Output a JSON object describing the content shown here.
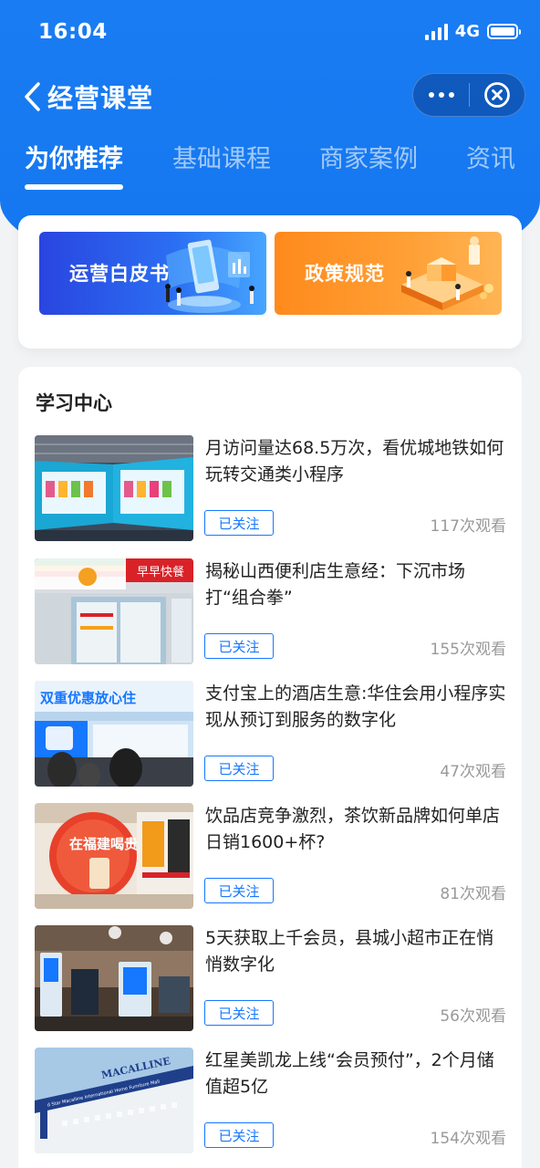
{
  "status_bar": {
    "time": "16:04",
    "network": "4G"
  },
  "nav": {
    "title": "经营课堂"
  },
  "tabs": [
    {
      "label": "为你推荐",
      "active": true
    },
    {
      "label": "基础课程",
      "active": false
    },
    {
      "label": "商家案例",
      "active": false
    },
    {
      "label": "资讯",
      "active": false
    }
  ],
  "banners": [
    {
      "label": "运营白皮书",
      "color": "#2b5ff0"
    },
    {
      "label": "政策规范",
      "color": "#ff9a2e"
    }
  ],
  "learning": {
    "title": "学习中心",
    "items": [
      {
        "title": "月访问量达68.5万次，看优城地铁如何玩转交通类小程序",
        "follow": "已关注",
        "views": "117次观看"
      },
      {
        "title": "揭秘山西便利店生意经：下沉市场打“组合拳”",
        "follow": "已关注",
        "views": "155次观看"
      },
      {
        "title": "支付宝上的酒店生意:华住会用小程序实现从预订到服务的数字化",
        "follow": "已关注",
        "views": "47次观看"
      },
      {
        "title": "饮品店竞争激烈，茶饮新品牌如何单店日销1600+杯?",
        "follow": "已关注",
        "views": "81次观看"
      },
      {
        "title": "5天获取上千会员，县城小超市正在悄悄数字化",
        "follow": "已关注",
        "views": "56次观看"
      },
      {
        "title": "红星美凯龙上线“会员预付”，2个月储值超5亿",
        "follow": "已关注",
        "views": "154次观看"
      }
    ]
  },
  "thumb_texts": {
    "store_sign": "早早快餐",
    "hotel_sign": "双重优惠放心住",
    "tea_sign": "在福建喝贵见",
    "mall_sign": "MACALLINE",
    "mall_sub": "Red Star Macalline International Home Furniture Mall"
  },
  "colors": {
    "accent": "#1677ff",
    "header": "#1a7cf2"
  }
}
